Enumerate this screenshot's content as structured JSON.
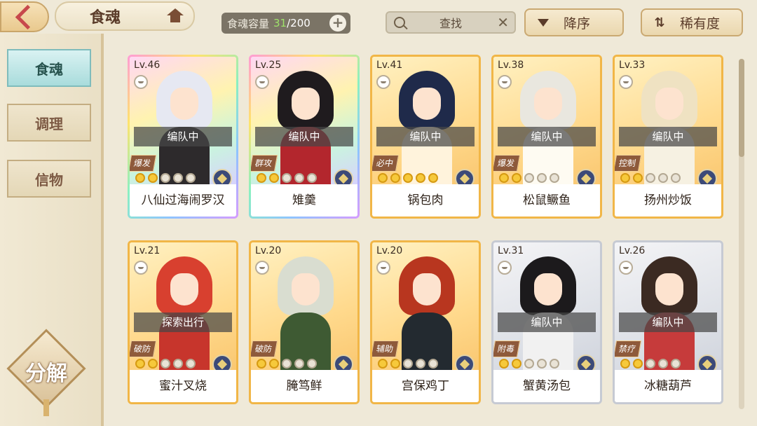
{
  "header": {
    "title": "食魂",
    "capacity_label": "食魂容量",
    "capacity_current": "31",
    "capacity_max": "/200",
    "add_symbol": "+",
    "search_label": "查找",
    "sort_order_label": "降序",
    "sort_by_label": "稀有度"
  },
  "sidebar": {
    "tabs": [
      {
        "label": "食魂",
        "active": true
      },
      {
        "label": "调理",
        "active": false
      },
      {
        "label": "信物",
        "active": false
      }
    ],
    "decompose_label": "分解"
  },
  "cards": [
    {
      "level": "Lv.46",
      "status": "编队中",
      "role": "爆发",
      "name": "八仙过海闹罗汉",
      "stars_filled": 2,
      "frame": "rainbow",
      "hair": "#e6e8f2",
      "outfit": "#2d2a2c"
    },
    {
      "level": "Lv.25",
      "status": "编队中",
      "role": "群攻",
      "name": "雉羹",
      "stars_filled": 2,
      "frame": "rainbow",
      "hair": "#1f1b1e",
      "outfit": "#b3262d"
    },
    {
      "level": "Lv.41",
      "status": "编队中",
      "role": "必中",
      "name": "锅包肉",
      "stars_filled": 5,
      "frame": "gold",
      "hair": "#1f2a4a",
      "outfit": "#fff3dc"
    },
    {
      "level": "Lv.38",
      "status": "编队中",
      "role": "爆发",
      "name": "松鼠鳜鱼",
      "stars_filled": 2,
      "frame": "gold",
      "hair": "#e9e7df",
      "outfit": "#fefbf2"
    },
    {
      "level": "Lv.33",
      "status": "编队中",
      "role": "控制",
      "name": "扬州炒饭",
      "stars_filled": 2,
      "frame": "gold",
      "hair": "#efe2c2",
      "outfit": "#f6f1e2"
    },
    {
      "level": "Lv.21",
      "status": "探索出行",
      "role": "破防",
      "name": "蜜汁叉烧",
      "stars_filled": 2,
      "frame": "gold",
      "hair": "#d8402f",
      "outfit": "#c7352c"
    },
    {
      "level": "Lv.20",
      "status": "",
      "role": "破防",
      "name": "腌笃鲜",
      "stars_filled": 2,
      "frame": "gold",
      "hair": "#d9ddd0",
      "outfit": "#3e5a33"
    },
    {
      "level": "Lv.20",
      "status": "",
      "role": "辅助",
      "name": "宫保鸡丁",
      "stars_filled": 2,
      "frame": "gold",
      "hair": "#b8361f",
      "outfit": "#232a30"
    },
    {
      "level": "Lv.31",
      "status": "编队中",
      "role": "附毒",
      "name": "蟹黄汤包",
      "stars_filled": 2,
      "frame": "silver",
      "hair": "#1c1a1c",
      "outfit": "#f1f1f1"
    },
    {
      "level": "Lv.26",
      "status": "编队中",
      "role": "禁疗",
      "name": "冰糖葫芦",
      "stars_filled": 2,
      "frame": "silver",
      "hair": "#3b2a22",
      "outfit": "#c63b3b"
    }
  ]
}
